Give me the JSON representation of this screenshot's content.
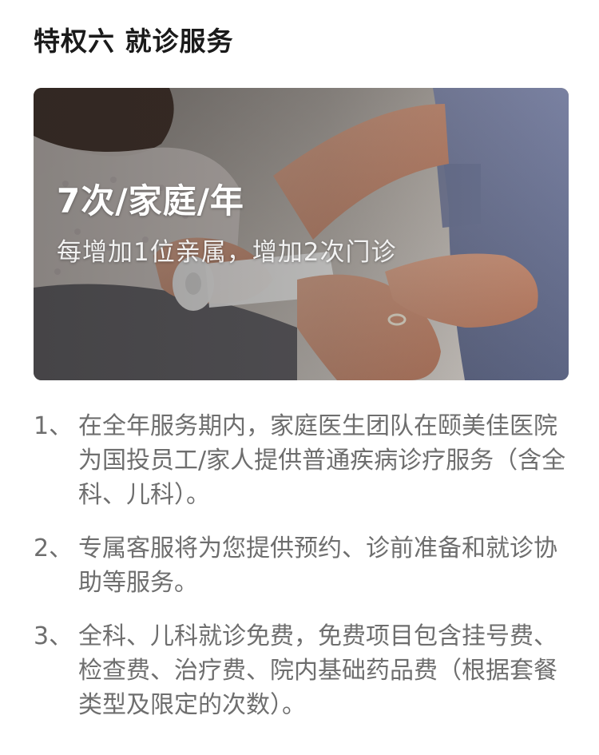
{
  "page": {
    "title": "特权六 就诊服务"
  },
  "hero": {
    "headline": "7次/家庭/年",
    "subline": "每增加1位亲属，增加2次门诊",
    "image_description_icon": "bandage-wrist-photo"
  },
  "list": {
    "items": [
      {
        "number": "1、",
        "text": "在全年服务期内，家庭医生团队在颐美佳医院为国投员工/家人提供普通疾病诊疗服务（含全科、儿科）。"
      },
      {
        "number": "2、",
        "text": "专属客服将为您提供预约、诊前准备和就诊协助等服务。"
      },
      {
        "number": "3、",
        "text": "全科、儿科就诊免费，免费项目包含挂号费、检查费、治疗费、院内基础药品费（根据套餐类型及限定的次数）。"
      }
    ]
  },
  "colors": {
    "title": "#1a1a1a",
    "body_text": "#6e6e6e",
    "hero_text": "#ffffff"
  }
}
